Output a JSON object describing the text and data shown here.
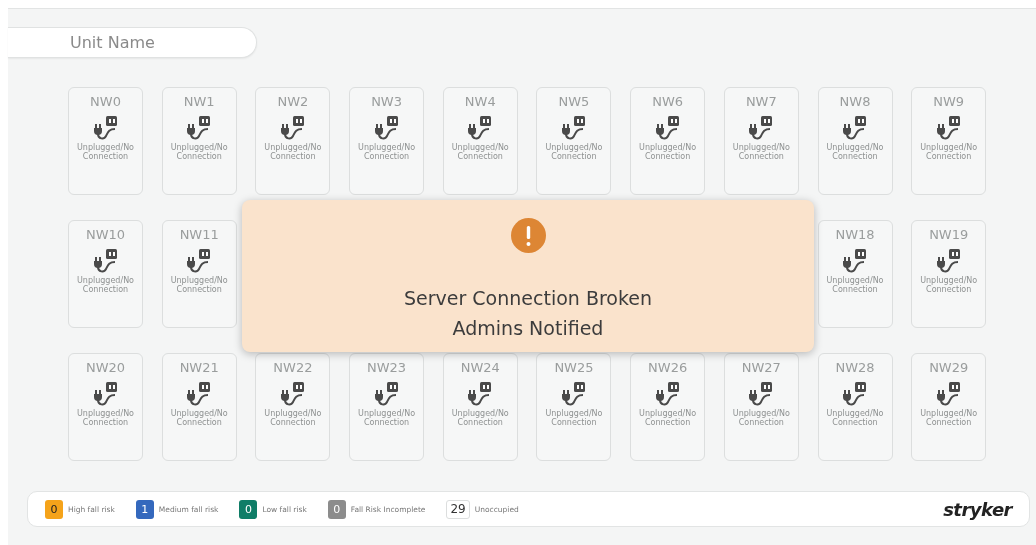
{
  "search": {
    "placeholder": "Unit Name"
  },
  "rows": [
    {
      "cards": [
        {
          "name": "NW0",
          "status": "Unplugged/No Connection"
        },
        {
          "name": "NW1",
          "status": "Unplugged/No Connection"
        },
        {
          "name": "NW2",
          "status": "Unplugged/No Connection"
        },
        {
          "name": "NW3",
          "status": "Unplugged/No Connection"
        },
        {
          "name": "NW4",
          "status": "Unplugged/No Connection"
        },
        {
          "name": "NW5",
          "status": "Unplugged/No Connection"
        },
        {
          "name": "NW6",
          "status": "Unplugged/No Connection"
        },
        {
          "name": "NW7",
          "status": "Unplugged/No Connection"
        },
        {
          "name": "NW8",
          "status": "Unplugged/No Connection"
        },
        {
          "name": "NW9",
          "status": "Unplugged/No Connection"
        }
      ]
    },
    {
      "cards": [
        {
          "name": "NW10",
          "status": "Unplugged/No Connection"
        },
        {
          "name": "NW11",
          "status": "Unplugged/No Connection"
        }
      ],
      "end_cards": [
        {
          "name": "NW18",
          "status": "Unplugged/No Connection"
        },
        {
          "name": "NW19",
          "status": "Unplugged/No Connection"
        }
      ]
    },
    {
      "cards": [
        {
          "name": "NW20",
          "status": "Unplugged/No Connection"
        },
        {
          "name": "NW21",
          "status": "Unplugged/No Connection"
        },
        {
          "name": "NW22",
          "status": "Unplugged/No Connection"
        },
        {
          "name": "NW23",
          "status": "Unplugged/No Connection"
        },
        {
          "name": "NW24",
          "status": "Unplugged/No Connection"
        },
        {
          "name": "NW25",
          "status": "Unplugged/No Connection"
        },
        {
          "name": "NW26",
          "status": "Unplugged/No Connection"
        },
        {
          "name": "NW27",
          "status": "Unplugged/No Connection"
        },
        {
          "name": "NW28",
          "status": "Unplugged/No Connection"
        },
        {
          "name": "NW29",
          "status": "Unplugged/No Connection"
        }
      ]
    }
  ],
  "alert": {
    "lines": [
      "Server Connection Broken",
      "Admins Notified"
    ]
  },
  "legend": [
    {
      "kind": "filled",
      "count": "0",
      "label": "High fall risk",
      "color": "#f5a31a"
    },
    {
      "kind": "filled",
      "count": "1",
      "label": "Medium fall risk",
      "color": "#3468bd"
    },
    {
      "kind": "filled",
      "count": "0",
      "label": "Low fall risk",
      "color": "#0f7d67"
    },
    {
      "kind": "filled",
      "count": "0",
      "label": "Fall Risk Incomplete",
      "color": "#8c8c8c"
    },
    {
      "kind": "outline",
      "count": "29",
      "label": "Unoccupied",
      "color": "#ffffff"
    }
  ],
  "logo": "stryker"
}
